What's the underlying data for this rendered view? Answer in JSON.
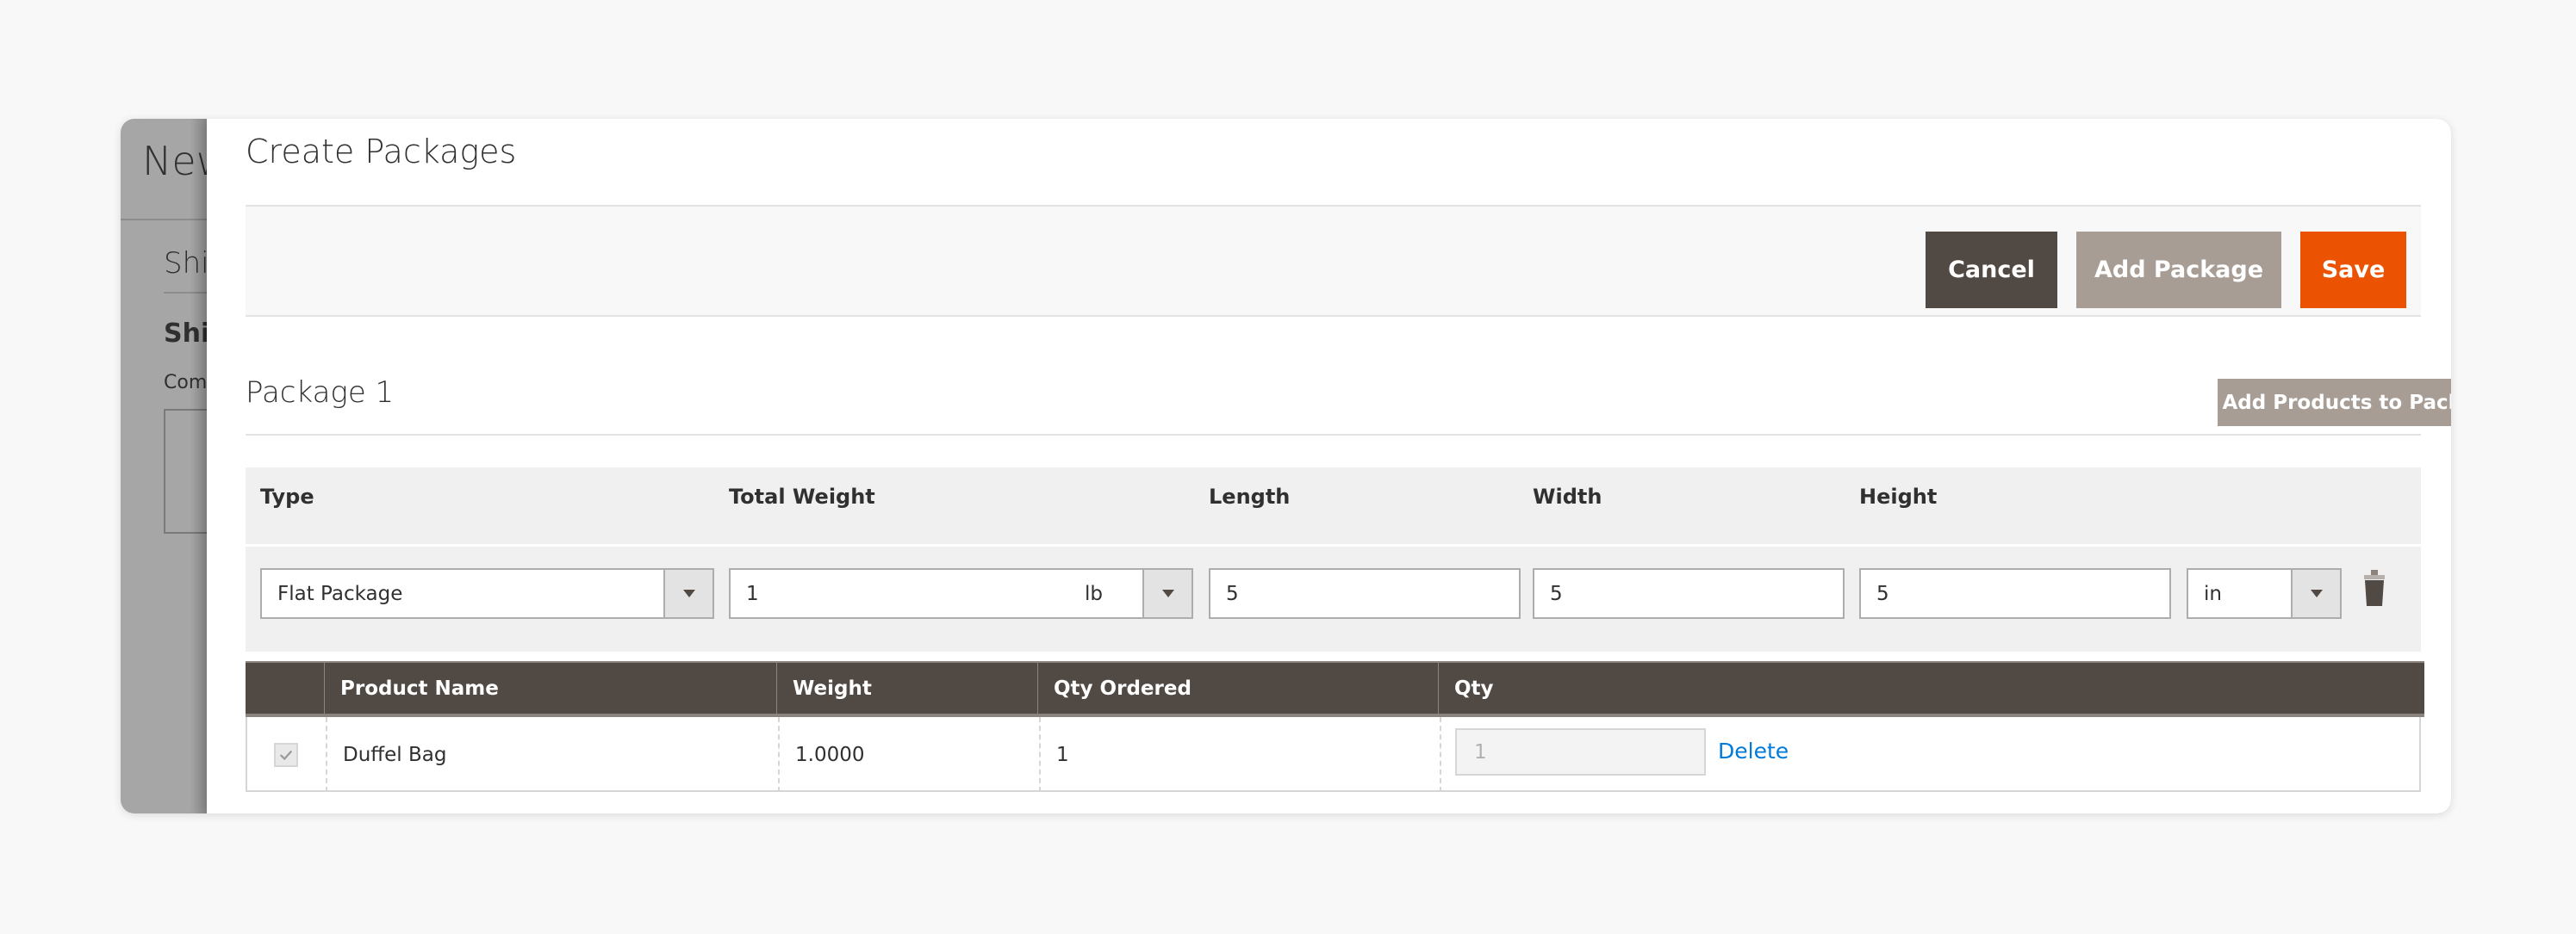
{
  "backdrop": {
    "title": "New Shipment",
    "section": "Shipping Information",
    "subsection": "Shipment Comments",
    "comment_label": "Comment Text"
  },
  "modal": {
    "title": "Create Packages",
    "close_icon": "close-icon",
    "toolbar": {
      "cancel_label": "Cancel",
      "add_package_label": "Add Package",
      "save_label": "Save"
    }
  },
  "package": {
    "title": "Package 1",
    "add_products_label": "Add Products to Package",
    "columns": {
      "type": "Type",
      "total_weight": "Total Weight",
      "length": "Length",
      "width": "Width",
      "height": "Height"
    },
    "values": {
      "type": "Flat Package",
      "total_weight": "1",
      "weight_unit": "lb",
      "length": "5",
      "width": "5",
      "height": "5",
      "dimension_unit": "in"
    },
    "delete_icon": "trash-icon"
  },
  "products": {
    "headers": [
      "",
      "Product Name",
      "Weight",
      "Qty Ordered",
      "Qty"
    ],
    "rows": [
      {
        "checked": true,
        "product_name": "Duffel Bag",
        "weight": "1.0000",
        "qty_ordered": "1",
        "qty": "1",
        "delete_label": "Delete"
      }
    ]
  },
  "colors": {
    "primary_dark": "#514943",
    "secondary": "#a79d95",
    "accent": "#eb5202",
    "link": "#007bdb"
  }
}
